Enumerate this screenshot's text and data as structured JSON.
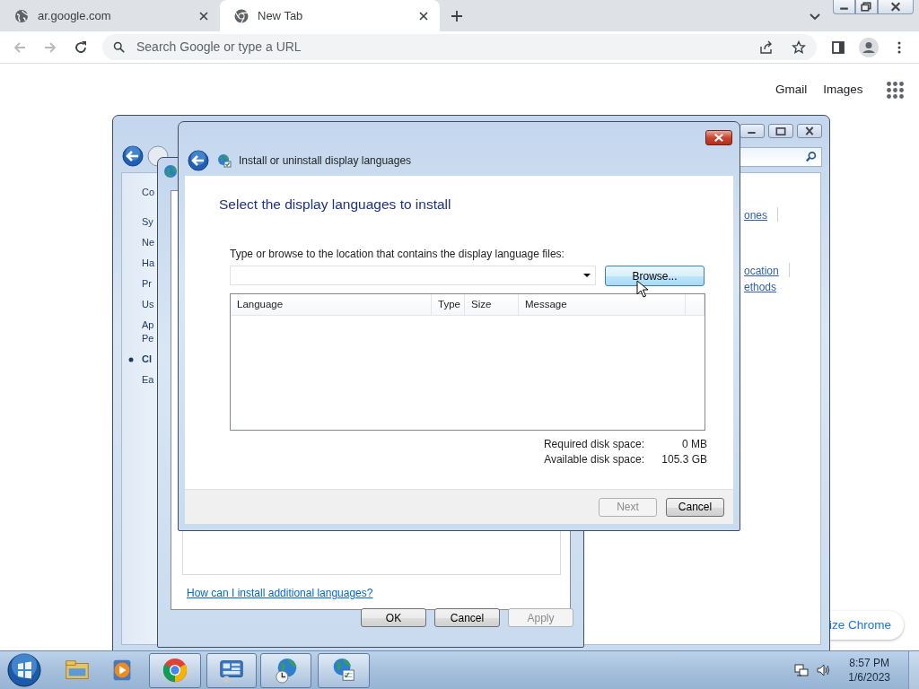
{
  "browser": {
    "tabs": [
      {
        "kind": "site",
        "title": "ar.google.com",
        "selected": false
      },
      {
        "kind": "newtab",
        "title": "New Tab",
        "selected": true
      }
    ],
    "address_bar": {
      "placeholder": "Search Google or type a URL"
    },
    "page_links": [
      "Gmail",
      "Images"
    ],
    "customize_button": "ize Chrome"
  },
  "control_panel": {
    "nav_items": [
      {
        "lines": [
          "Co"
        ],
        "selected": false
      },
      {
        "lines": [
          "Sy"
        ],
        "selected": false
      },
      {
        "lines": [
          "Ne"
        ],
        "selected": false
      },
      {
        "lines": [
          "Ha"
        ],
        "selected": false
      },
      {
        "lines": [
          "Pr"
        ],
        "selected": false
      },
      {
        "lines": [
          "Us"
        ],
        "selected": false
      },
      {
        "lines": [
          "Ap",
          "Pe"
        ],
        "selected": false
      },
      {
        "lines": [
          "Cl"
        ],
        "selected": true
      },
      {
        "lines": [
          "Ea"
        ],
        "selected": false
      }
    ],
    "link_groups": [
      [
        "ones"
      ],
      [
        "ocation",
        "ethods"
      ]
    ]
  },
  "region_dialog": {
    "help_link": "How can I install additional languages?",
    "buttons": [
      {
        "label": "OK",
        "disabled": false
      },
      {
        "label": "Cancel",
        "disabled": false
      },
      {
        "label": "Apply",
        "disabled": true
      }
    ]
  },
  "install_dialog": {
    "title": "Install or uninstall display languages",
    "heading": "Select the display languages to install",
    "location_label": "Type or browse to the location that contains the display language files:",
    "browse_button": "Browse...",
    "columns": [
      "Language",
      "Type",
      "Size",
      "Message"
    ],
    "disk_space": [
      {
        "label": "Required disk space:",
        "value": "0 MB"
      },
      {
        "label": "Available disk space:",
        "value": "105.3 GB"
      }
    ],
    "buttons": [
      {
        "label": "Next",
        "disabled": true
      },
      {
        "label": "Cancel",
        "disabled": false
      }
    ]
  },
  "taskbar": {
    "apps": [
      {
        "kind": "explorer",
        "running": false
      },
      {
        "kind": "media",
        "running": false
      },
      {
        "kind": "chrome",
        "running": true
      },
      {
        "kind": "control-panel",
        "running": true
      },
      {
        "kind": "globe-clock",
        "running": true
      },
      {
        "kind": "globe-check",
        "running": true
      }
    ],
    "time": "8:57 PM",
    "date": "1/6/2023"
  }
}
